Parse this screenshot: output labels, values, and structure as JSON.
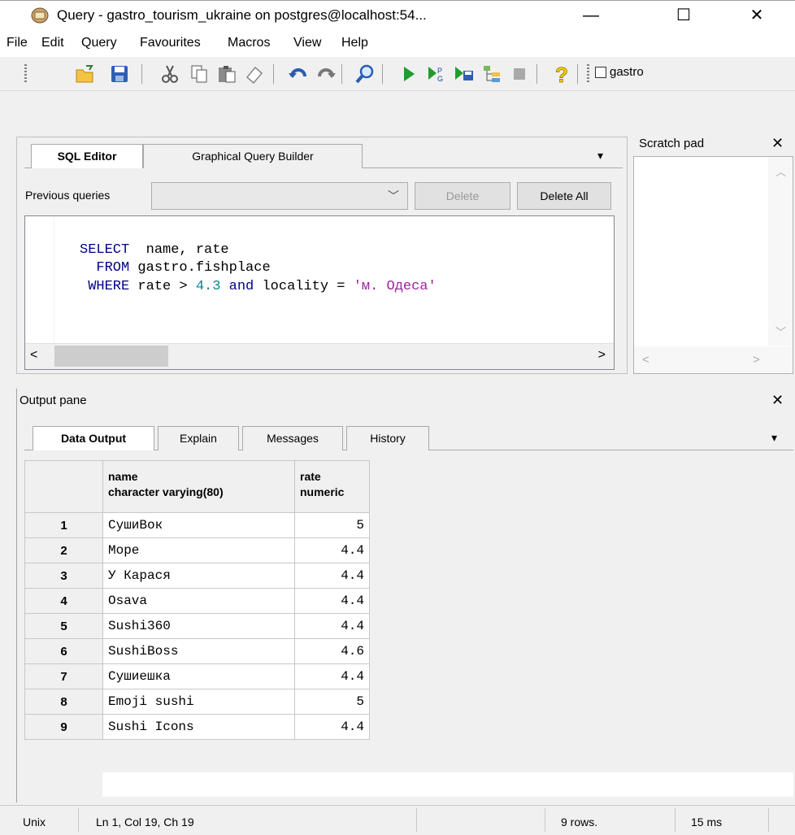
{
  "window": {
    "title": "Query - gastro_tourism_ukraine on postgres@localhost:54...",
    "minimize": "—",
    "maximize": "☐",
    "close": "✕"
  },
  "menu": [
    "File",
    "Edit",
    "Query",
    "Favourites",
    "Macros",
    "View",
    "Help"
  ],
  "toolbar": {
    "db_checkbox_label": "gastro"
  },
  "editor": {
    "tabs": [
      "SQL Editor",
      "Graphical Query Builder"
    ],
    "previous_queries_label": "Previous queries",
    "delete_label": "Delete",
    "delete_all_label": "Delete All",
    "code_lines": [
      {
        "kw": "SELECT",
        "rest": "  name, rate"
      },
      {
        "kw": "  FROM",
        "rest": " gastro.fishplace"
      },
      {
        "kw": " WHERE",
        "rest1": " rate > ",
        "num": "4.3",
        "kw2": " and",
        "rest2": " locality = ",
        "str": "'м. Одеса'"
      }
    ]
  },
  "scratch": {
    "title": "Scratch pad",
    "close": "✕"
  },
  "output": {
    "title": "Output pane",
    "close": "✕",
    "tabs": [
      "Data Output",
      "Explain",
      "Messages",
      "History"
    ],
    "columns": [
      {
        "name": "name",
        "type": "character varying(80)"
      },
      {
        "name": "rate",
        "type": "numeric"
      }
    ],
    "rows": [
      {
        "n": "1",
        "name": "СушиВок",
        "rate": "5"
      },
      {
        "n": "2",
        "name": "Море",
        "rate": "4.4"
      },
      {
        "n": "3",
        "name": "У Карася",
        "rate": "4.4"
      },
      {
        "n": "4",
        "name": "Osava",
        "rate": "4.4"
      },
      {
        "n": "5",
        "name": "Sushi360",
        "rate": "4.4"
      },
      {
        "n": "6",
        "name": "SushiBoss",
        "rate": "4.6"
      },
      {
        "n": "7",
        "name": "Сушиешка",
        "rate": "4.4"
      },
      {
        "n": "8",
        "name": "Emoji sushi",
        "rate": "5"
      },
      {
        "n": "9",
        "name": "Sushi Icons",
        "rate": "4.4"
      }
    ]
  },
  "status": {
    "line_ending": "Unix",
    "position": "Ln 1, Col 19, Ch 19",
    "rows": "9 rows.",
    "time": "15 ms"
  }
}
